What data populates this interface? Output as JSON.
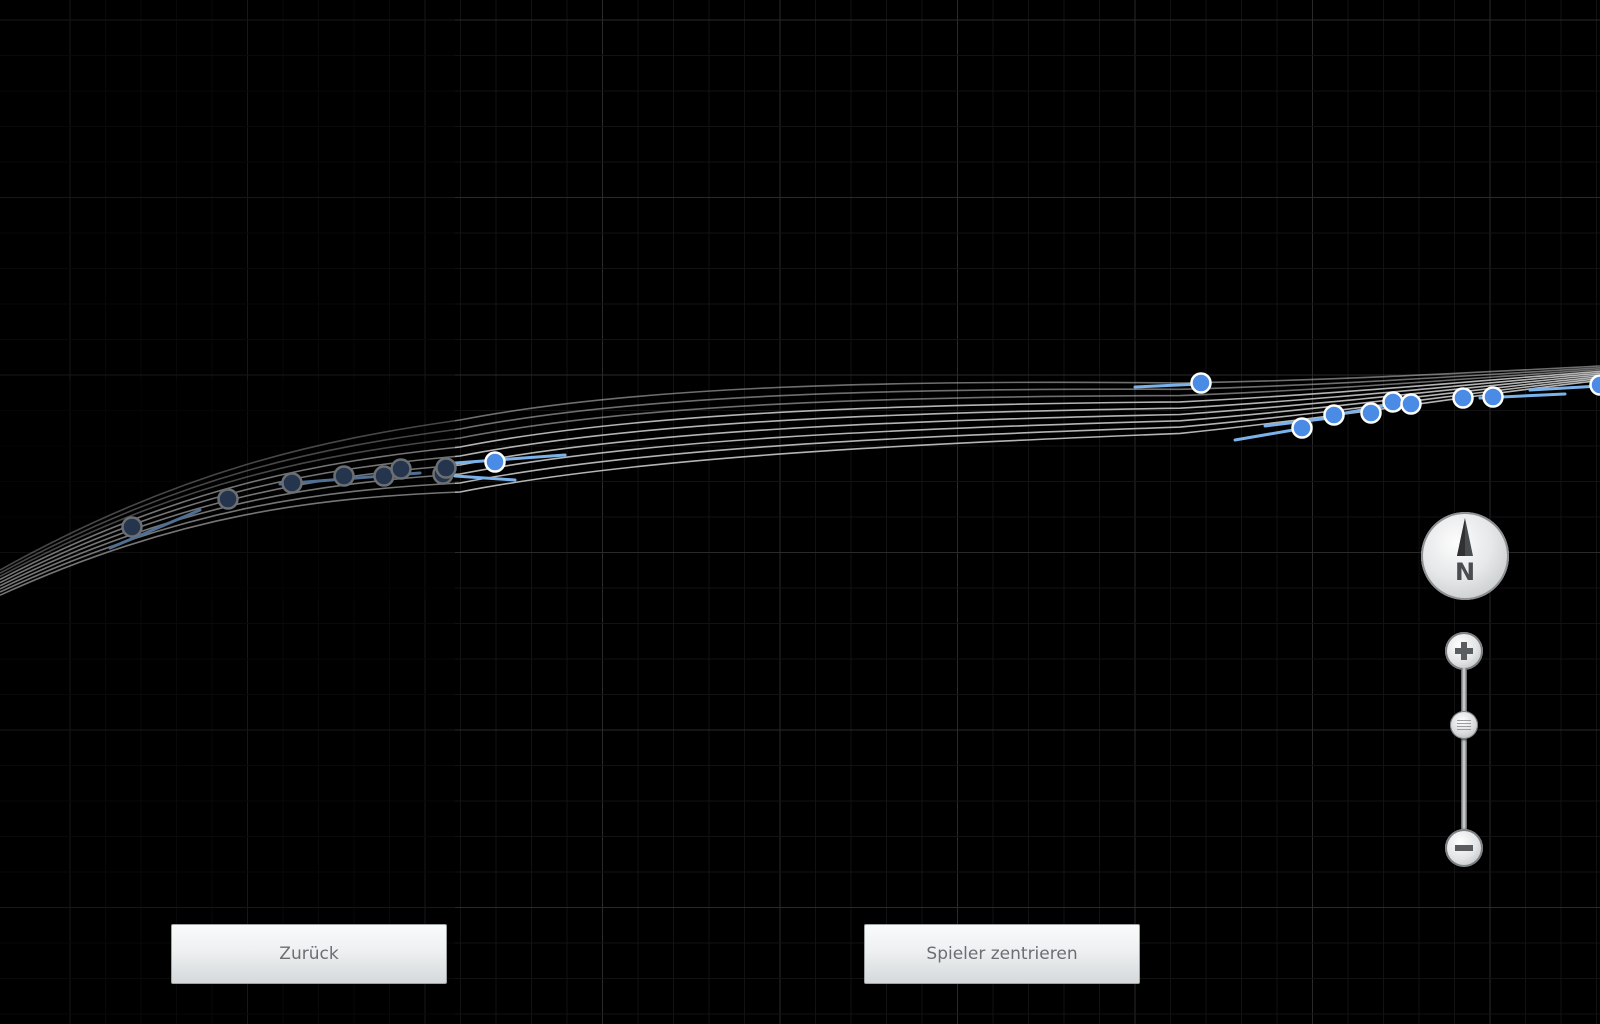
{
  "buttons": {
    "back_label": "Zurück",
    "center_player_label": "Spieler zentrieren"
  },
  "compass": {
    "letter": "N",
    "icon": "compass-north-icon"
  },
  "zoom": {
    "in_icon": "plus-icon",
    "out_icon": "minus-icon",
    "level": 0.35
  },
  "colors": {
    "background": "#000000",
    "grid": "#1f1f1f",
    "track_line": "#c8c8c8",
    "active_marker": "#4a8be6",
    "active_trail": "#7ab2ea",
    "inactive_marker": "#24354d",
    "inactive_trail": "#4f6f93",
    "button_text": "#6b6f72"
  },
  "map": {
    "active_marker_count": 12,
    "inactive_marker_count": 8
  }
}
